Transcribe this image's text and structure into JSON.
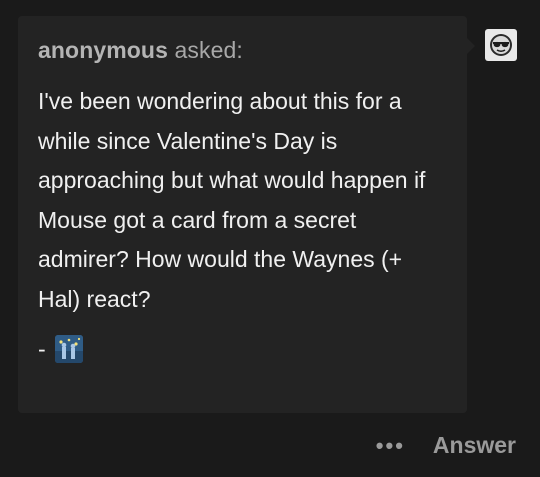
{
  "ask": {
    "asker": "anonymous",
    "verb": "asked:",
    "body": "I've been wondering about this for a while since Valentine's Day is approaching but what would happen if Mouse got a card from a secret admirer? How would the Waynes (+ Hal) react?",
    "sign_dash": "-",
    "sign_emoji_icon": "starry-night-image-icon"
  },
  "avatar": {
    "icon": "sunglasses-face-icon"
  },
  "footer": {
    "more_label": "•••",
    "answer_label": "Answer"
  },
  "colors": {
    "background": "#1a1a1a",
    "bubble": "#232323",
    "text": "#f0f0f0",
    "muted": "#a8a8a8"
  }
}
